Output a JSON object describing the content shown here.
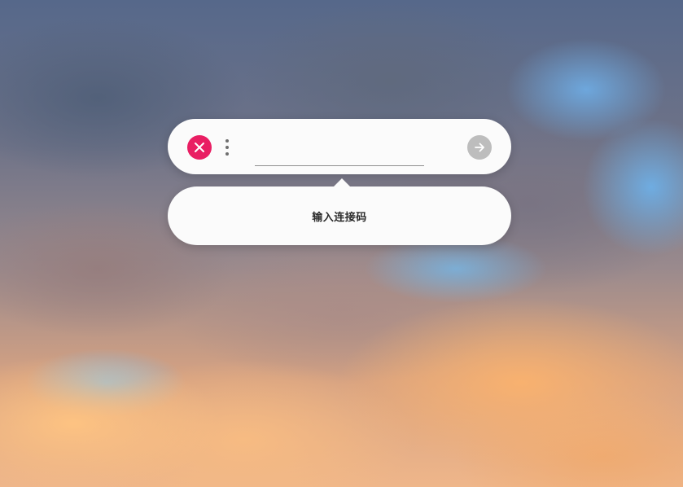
{
  "background": {
    "description_icon": "sunset-clouds-wallpaper"
  },
  "toolbar": {
    "close_icon": "close-icon",
    "close_color": "#e91e63",
    "more_icon": "more-vertical-icon",
    "input_value": "",
    "input_placeholder": "",
    "go_icon": "arrow-right-icon",
    "go_color": "#bdbdbd"
  },
  "tooltip": {
    "text": "输入连接码"
  }
}
